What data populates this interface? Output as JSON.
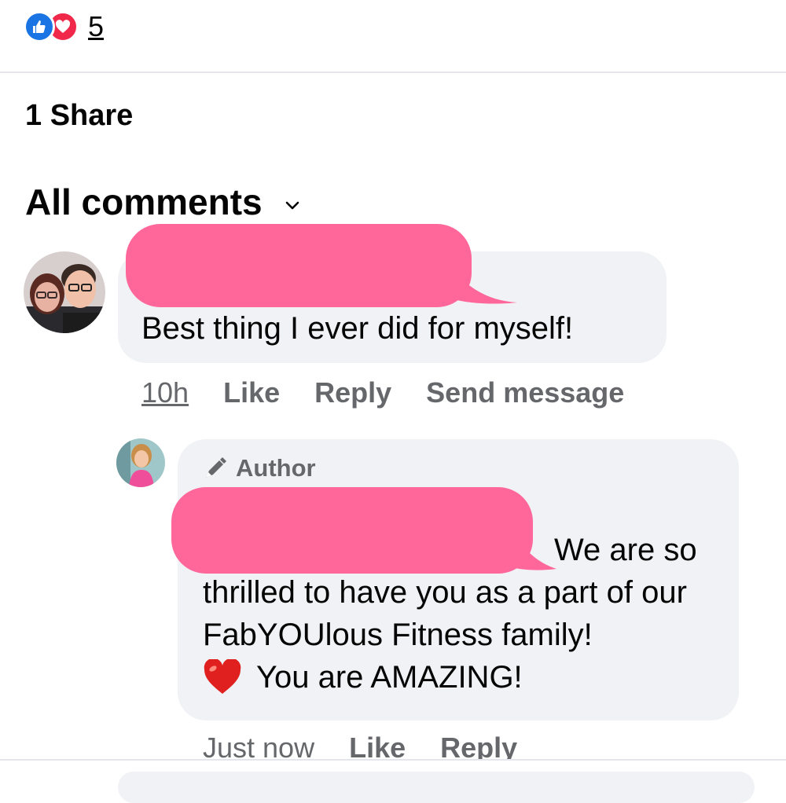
{
  "reactions": {
    "icons": [
      "like-icon",
      "love-icon"
    ],
    "count": "5"
  },
  "shares": "1 Share",
  "comments_filter": {
    "label": "All comments",
    "icon": "chevron-down-icon"
  },
  "comment": {
    "text": "Best thing I ever did for myself!",
    "time": "10h",
    "like": "Like",
    "reply": "Reply",
    "send_message": "Send message"
  },
  "reply": {
    "badge": "Author",
    "badge_icon": "pen-icon",
    "line1": "We are so",
    "rest": "thrilled to have you as a part of our FabYOUlous Fitness family!",
    "heart_icon": "red-heart-icon",
    "amazing": "You are AMAZING!",
    "time": "Just now",
    "like": "Like",
    "reply": "Reply"
  },
  "colors": {
    "redaction": "#ff6699",
    "bubble": "#f0f2f5",
    "meta": "#65676b",
    "like_blue": "#1b74e4",
    "love_red": "#f02849"
  }
}
